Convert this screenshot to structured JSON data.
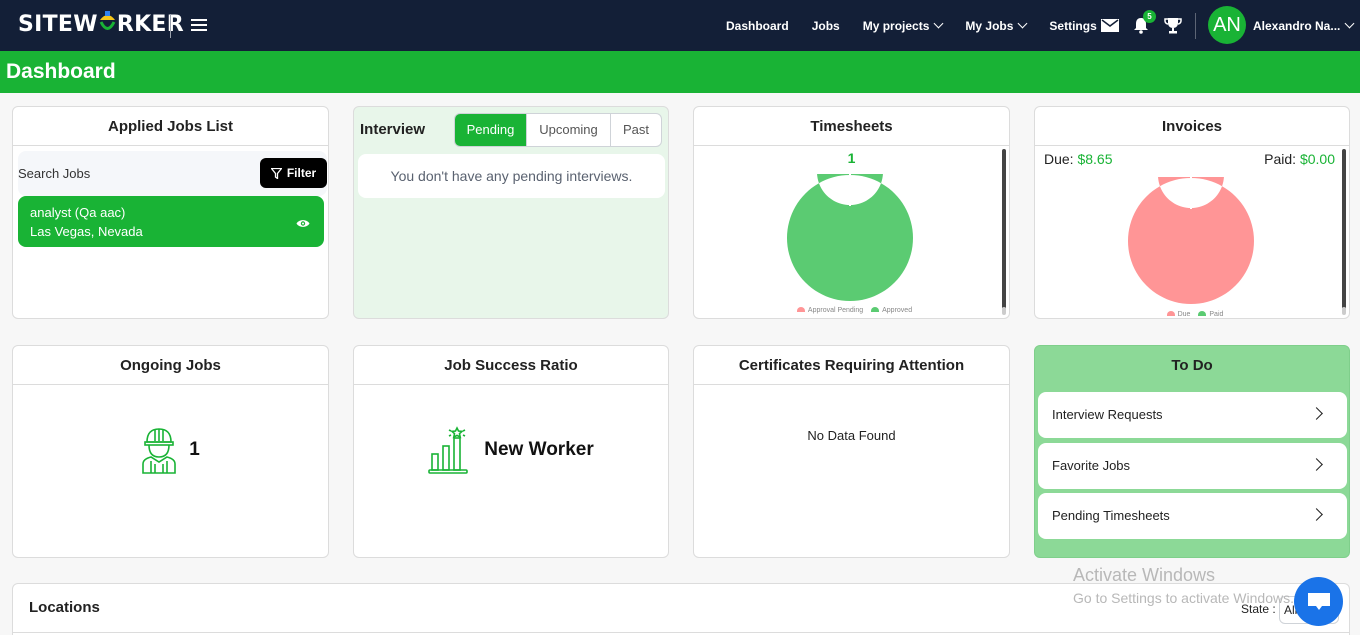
{
  "brand": {
    "name_pre": "SITEW",
    "name_post": "RKER"
  },
  "nav": {
    "links": [
      {
        "label": "Dashboard",
        "dropdown": false
      },
      {
        "label": "Jobs",
        "dropdown": false
      },
      {
        "label": "My projects",
        "dropdown": true
      },
      {
        "label": "My Jobs",
        "dropdown": true
      },
      {
        "label": "Settings",
        "dropdown": true
      }
    ],
    "icons": [
      "mail-icon",
      "bell-icon",
      "trophy-icon"
    ],
    "notification_count": "5",
    "user": {
      "initials": "AN",
      "name": "Alexandro Na..."
    }
  },
  "page_title": "Dashboard",
  "applied_jobs": {
    "title": "Applied Jobs List",
    "search_label": "Search Jobs",
    "filter_label": "Filter",
    "jobs": [
      {
        "title": "analyst (Qa aac)",
        "location": "Las Vegas, Nevada"
      }
    ]
  },
  "interview": {
    "title": "Interview",
    "tabs": [
      "Pending",
      "Upcoming",
      "Past"
    ],
    "active_tab": "Pending",
    "empty_message": "You don't have any pending interviews."
  },
  "timesheets": {
    "title": "Timesheets",
    "total": "1",
    "legend": [
      "Approval Pending",
      "Approved"
    ]
  },
  "invoices": {
    "title": "Invoices",
    "due_label": "Due:",
    "due_value": "$8.65",
    "paid_label": "Paid:",
    "paid_value": "$0.00",
    "legend": [
      "Due",
      "Paid"
    ]
  },
  "ongoing_jobs": {
    "title": "Ongoing Jobs",
    "count": "1"
  },
  "job_success": {
    "title": "Job Success Ratio",
    "status": "New Worker"
  },
  "certificates": {
    "title": "Certificates Requiring Attention",
    "empty_message": "No Data Found"
  },
  "todo": {
    "title": "To Do",
    "items": [
      "Interview Requests",
      "Favorite Jobs",
      "Pending Timesheets"
    ]
  },
  "locations": {
    "title": "Locations",
    "state_label": "State :",
    "state_value": "All"
  },
  "watermark": {
    "line1": "Activate Windows",
    "line2": "Go to Settings to activate Windows."
  },
  "colors": {
    "brand_green": "#19b335",
    "nav_dark": "#131f37",
    "due_pink": "#ff9596",
    "approved_green": "#5bcb72",
    "todo_green": "#8cd997",
    "chat_blue": "#1a73e8"
  },
  "chart_data": [
    {
      "type": "pie",
      "title": "Timesheets",
      "categories": [
        "Approval Pending",
        "Approved"
      ],
      "values": [
        0,
        1
      ],
      "colors": [
        "#ff9596",
        "#5bcb72"
      ],
      "legend": "bottom"
    },
    {
      "type": "pie",
      "title": "Invoices",
      "categories": [
        "Due",
        "Paid"
      ],
      "values": [
        8.65,
        0.0
      ],
      "colors": [
        "#ff9596",
        "#5bcb72"
      ],
      "legend": "bottom"
    }
  ]
}
